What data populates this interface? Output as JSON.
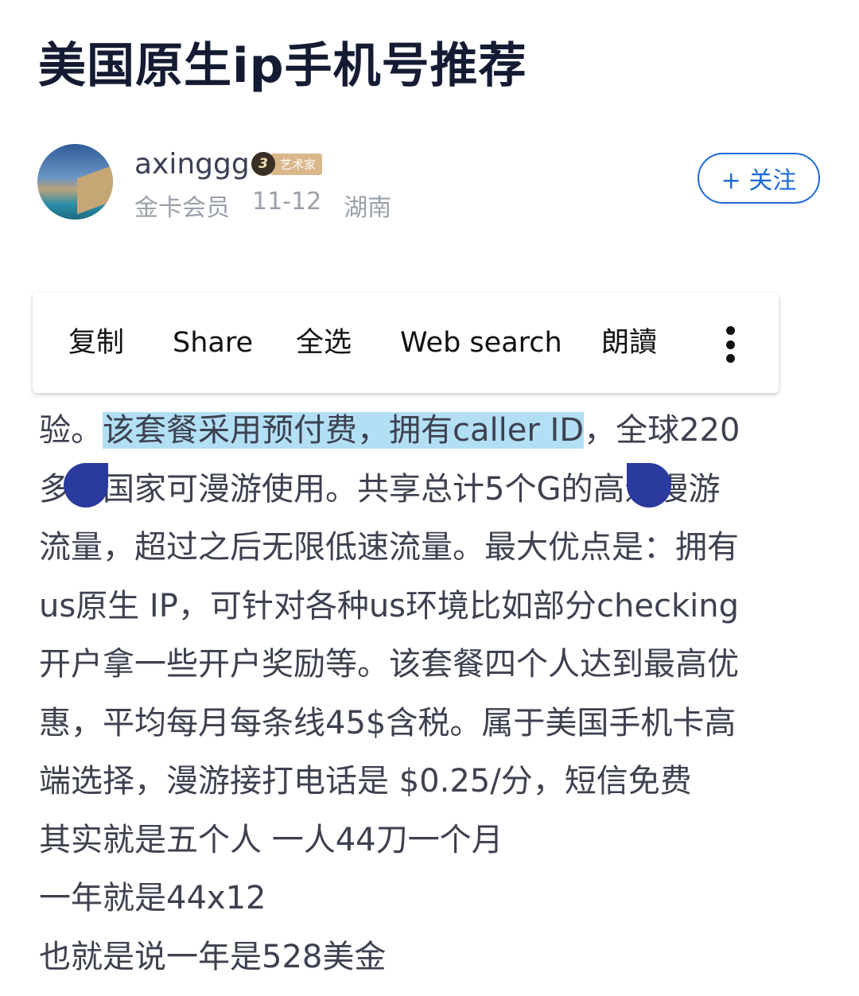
{
  "post": {
    "title": "美国原生ip手机号推荐"
  },
  "author": {
    "name": "axinggg",
    "badge_level": "3",
    "badge_label": "艺术家",
    "membership": "金卡会员",
    "date": "11-12",
    "location": "湖南",
    "follow_label": "+ 关注"
  },
  "context_menu": {
    "items": [
      "复制",
      "Share",
      "全选",
      "Web search",
      "朗讀"
    ],
    "more_icon": "more-vertical-icon"
  },
  "content": {
    "line1_pre": "验。",
    "line1_selected": "该套餐采用预付费，拥有caller ID",
    "line1_post": "，全球220",
    "lines": [
      "多个国家可漫游使用。共享总计5个G的高速漫游",
      "流量，超过之后无限低速流量。最大优点是：拥有",
      "us原生 IP，可针对各种us环境比如部分checking",
      "开户拿一些开户奖励等。该套餐四个人达到最高优",
      "惠，平均每月每条线45$含税。属于美国手机卡高",
      "端选择，漫游接打电话是 $0.25/分，短信免费",
      "其实就是五个人 一人44刀一个月",
      "一年就是44x12",
      "也就是说一年是528美金"
    ]
  },
  "colors": {
    "selection": "#b2dff4",
    "handle": "#2b3a9e",
    "follow_accent": "#1e6ad6"
  }
}
